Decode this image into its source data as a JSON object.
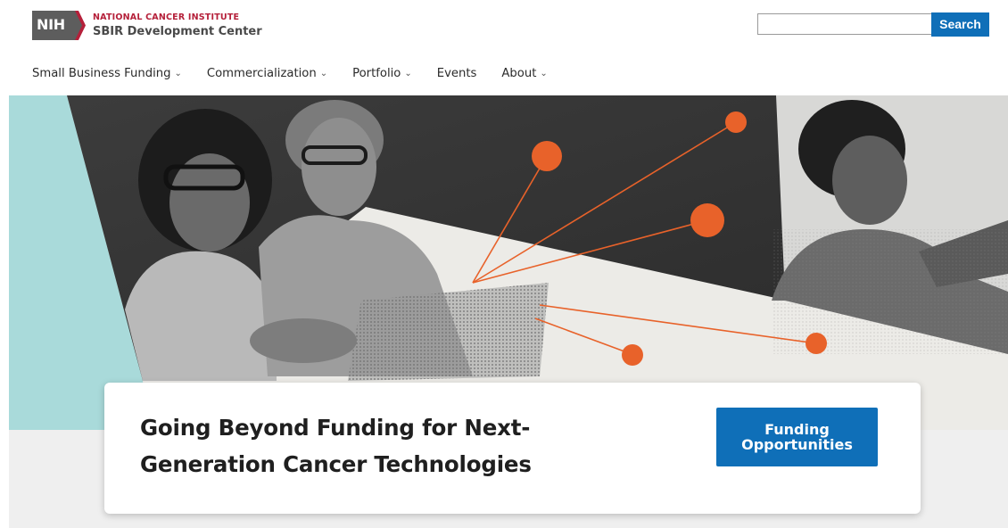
{
  "header": {
    "nih_badge": "NIH",
    "institute": "NATIONAL CANCER INSTITUTE",
    "center": "SBIR Development Center",
    "search": {
      "placeholder": "",
      "value": "",
      "button_label": "Search"
    }
  },
  "nav": {
    "items": [
      {
        "label": "Small Business Funding",
        "has_dropdown": true
      },
      {
        "label": "Commercialization",
        "has_dropdown": true
      },
      {
        "label": "Portfolio",
        "has_dropdown": true
      },
      {
        "label": "Events",
        "has_dropdown": false
      },
      {
        "label": "About",
        "has_dropdown": true
      }
    ],
    "dropdown_icon": "chevron-down-icon"
  },
  "hero": {
    "image": "people-collaborating-network-photo",
    "accent_color": "#a9dada",
    "dot_color": "#e8622a"
  },
  "card": {
    "heading": "Going Beyond Funding for Next-Generation Cancer Technologies",
    "cta_label": "Funding Opportunities"
  },
  "colors": {
    "brand_blue": "#0f6fb8",
    "nci_red": "#b5203a",
    "nih_gray": "#5d5d5d"
  }
}
